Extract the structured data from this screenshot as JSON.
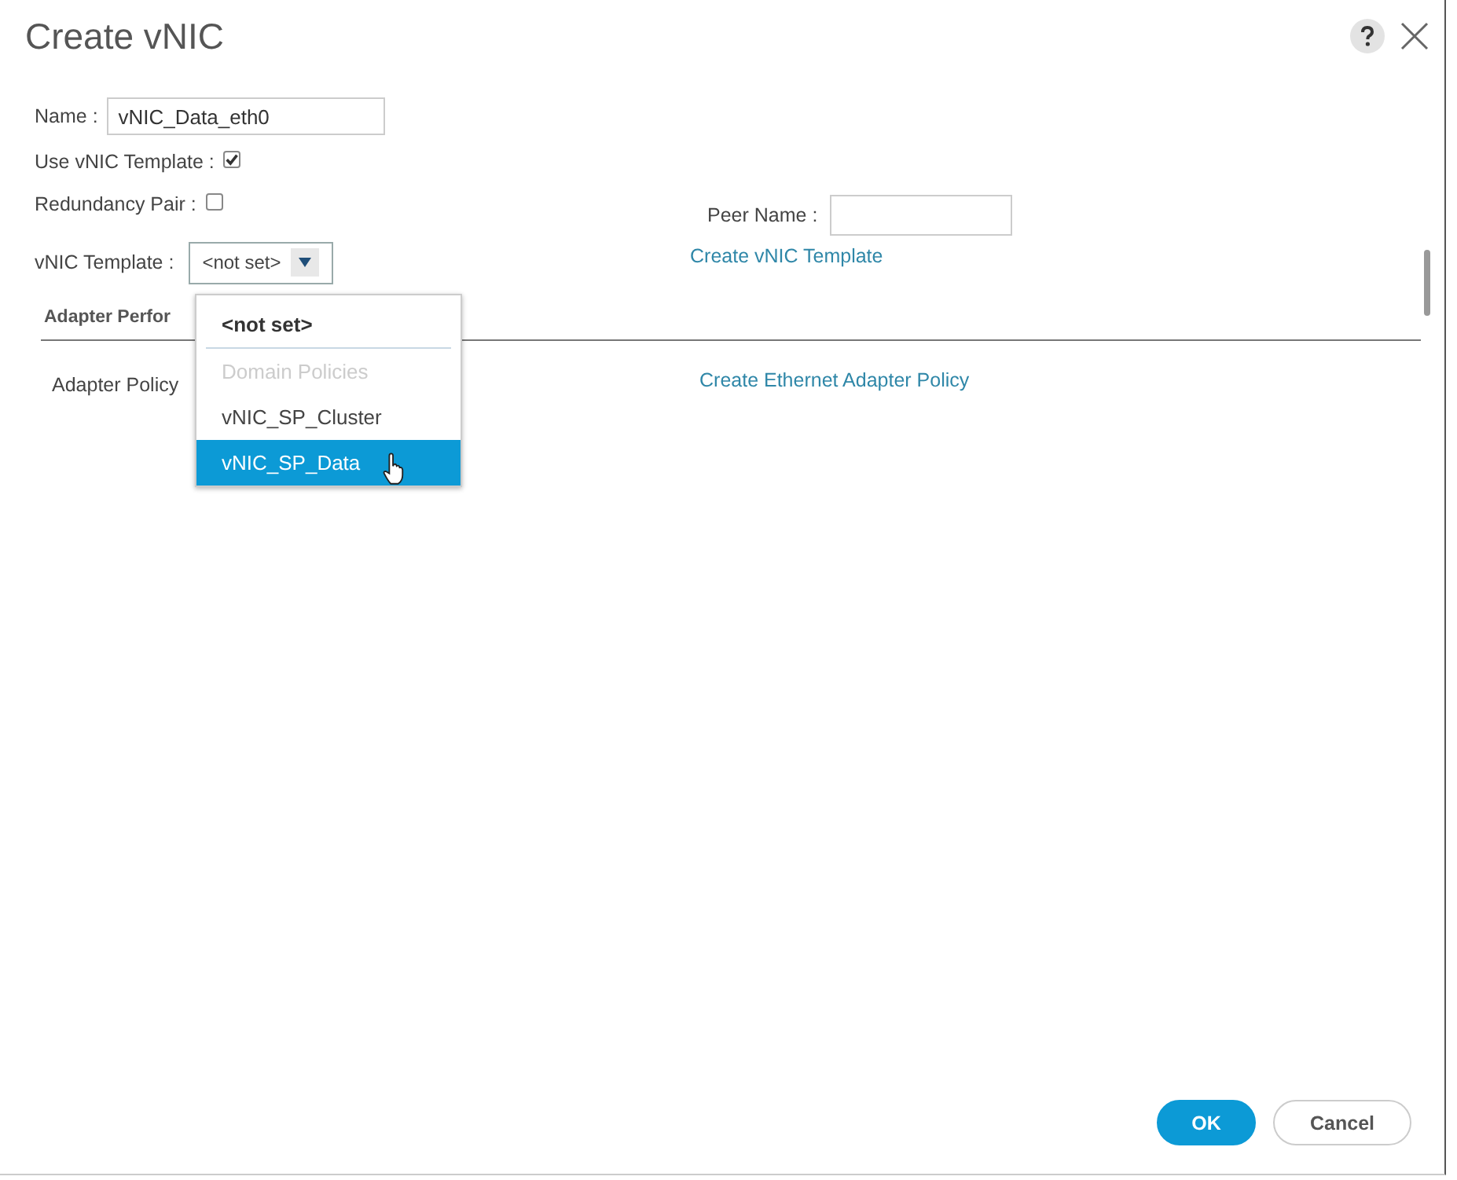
{
  "dialog": {
    "title": "Create vNIC"
  },
  "fields": {
    "name": {
      "label": "Name :",
      "value": "vNIC_Data_eth0"
    },
    "use_template": {
      "label": "Use vNIC Template :",
      "checked": true
    },
    "redundancy_pair": {
      "label": "Redundancy Pair :",
      "checked": false
    },
    "peer_name": {
      "label": "Peer Name :"
    },
    "vnic_template": {
      "label": "vNIC Template :",
      "value": "<not set>",
      "expanded": true
    },
    "create_template_link": "Create vNIC Template"
  },
  "dropdown": [
    {
      "kind": "option",
      "label": "<not set>",
      "bold": true,
      "selected": false
    },
    {
      "kind": "header",
      "label": "Domain Policies"
    },
    {
      "kind": "option",
      "label": "vNIC_SP_Cluster",
      "bold": false,
      "selected": false
    },
    {
      "kind": "option",
      "label": "vNIC_SP_Data",
      "bold": false,
      "selected": true
    }
  ],
  "section": {
    "title": "Adapter Perfor",
    "adapter_policy_label": "Adapter Policy",
    "link": "Create Ethernet Adapter Policy"
  },
  "buttons": [
    {
      "label": "OK",
      "primary": true
    },
    {
      "label": "Cancel",
      "primary": false
    }
  ]
}
